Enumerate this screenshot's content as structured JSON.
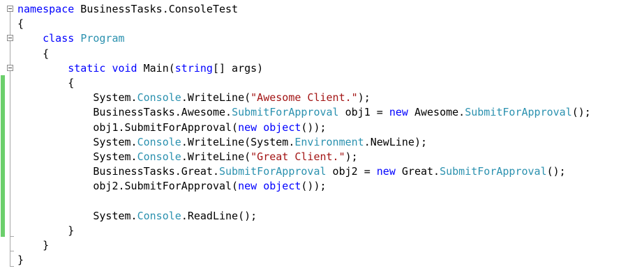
{
  "lines": [
    {
      "indent": "",
      "parts": [
        {
          "t": "namespace",
          "c": "kw"
        },
        {
          "t": " BusinessTasks.ConsoleTest",
          "c": ""
        }
      ]
    },
    {
      "indent": "",
      "parts": [
        {
          "t": "{",
          "c": ""
        }
      ]
    },
    {
      "indent": "    ",
      "parts": [
        {
          "t": "class",
          "c": "kw"
        },
        {
          "t": " ",
          "c": ""
        },
        {
          "t": "Program",
          "c": "ty"
        }
      ]
    },
    {
      "indent": "    ",
      "parts": [
        {
          "t": "{",
          "c": ""
        }
      ]
    },
    {
      "indent": "        ",
      "parts": [
        {
          "t": "static",
          "c": "kw"
        },
        {
          "t": " ",
          "c": ""
        },
        {
          "t": "void",
          "c": "kw"
        },
        {
          "t": " Main(",
          "c": ""
        },
        {
          "t": "string",
          "c": "kw"
        },
        {
          "t": "[] args)",
          "c": ""
        }
      ]
    },
    {
      "indent": "        ",
      "parts": [
        {
          "t": "{",
          "c": ""
        }
      ]
    },
    {
      "indent": "            ",
      "parts": [
        {
          "t": "System.",
          "c": ""
        },
        {
          "t": "Console",
          "c": "ty"
        },
        {
          "t": ".WriteLine(",
          "c": ""
        },
        {
          "t": "\"Awesome Client.\"",
          "c": "str"
        },
        {
          "t": ");",
          "c": ""
        }
      ]
    },
    {
      "indent": "            ",
      "parts": [
        {
          "t": "BusinessTasks.Awesome.",
          "c": ""
        },
        {
          "t": "SubmitForApproval",
          "c": "ty"
        },
        {
          "t": " obj1 = ",
          "c": ""
        },
        {
          "t": "new",
          "c": "kw"
        },
        {
          "t": " Awesome.",
          "c": ""
        },
        {
          "t": "SubmitForApproval",
          "c": "ty"
        },
        {
          "t": "();",
          "c": ""
        }
      ]
    },
    {
      "indent": "            ",
      "parts": [
        {
          "t": "obj1.SubmitForApproval(",
          "c": ""
        },
        {
          "t": "new",
          "c": "kw"
        },
        {
          "t": " ",
          "c": ""
        },
        {
          "t": "object",
          "c": "kw"
        },
        {
          "t": "());",
          "c": ""
        }
      ]
    },
    {
      "indent": "            ",
      "parts": [
        {
          "t": "System.",
          "c": ""
        },
        {
          "t": "Console",
          "c": "ty"
        },
        {
          "t": ".WriteLine(System.",
          "c": ""
        },
        {
          "t": "Environment",
          "c": "ty"
        },
        {
          "t": ".NewLine);",
          "c": ""
        }
      ]
    },
    {
      "indent": "            ",
      "parts": [
        {
          "t": "System.",
          "c": ""
        },
        {
          "t": "Console",
          "c": "ty"
        },
        {
          "t": ".WriteLine(",
          "c": ""
        },
        {
          "t": "\"Great Client.\"",
          "c": "str"
        },
        {
          "t": ");",
          "c": ""
        }
      ]
    },
    {
      "indent": "            ",
      "parts": [
        {
          "t": "BusinessTasks.Great.",
          "c": ""
        },
        {
          "t": "SubmitForApproval",
          "c": "ty"
        },
        {
          "t": " obj2 = ",
          "c": ""
        },
        {
          "t": "new",
          "c": "kw"
        },
        {
          "t": " Great.",
          "c": ""
        },
        {
          "t": "SubmitForApproval",
          "c": "ty"
        },
        {
          "t": "();",
          "c": ""
        }
      ]
    },
    {
      "indent": "            ",
      "parts": [
        {
          "t": "obj2.SubmitForApproval(",
          "c": ""
        },
        {
          "t": "new",
          "c": "kw"
        },
        {
          "t": " ",
          "c": ""
        },
        {
          "t": "object",
          "c": "kw"
        },
        {
          "t": "());",
          "c": ""
        }
      ]
    },
    {
      "indent": "",
      "parts": []
    },
    {
      "indent": "            ",
      "parts": [
        {
          "t": "System.",
          "c": ""
        },
        {
          "t": "Console",
          "c": "ty"
        },
        {
          "t": ".ReadLine();",
          "c": ""
        }
      ]
    },
    {
      "indent": "        ",
      "parts": [
        {
          "t": "}",
          "c": ""
        }
      ]
    },
    {
      "indent": "    ",
      "parts": [
        {
          "t": "}",
          "c": ""
        }
      ]
    },
    {
      "indent": "",
      "parts": [
        {
          "t": "}",
          "c": ""
        }
      ]
    }
  ],
  "colors": {
    "keyword": "#0000ff",
    "type": "#2b91af",
    "string": "#a31515",
    "changed_lines_marker": "#6ccf6c"
  }
}
